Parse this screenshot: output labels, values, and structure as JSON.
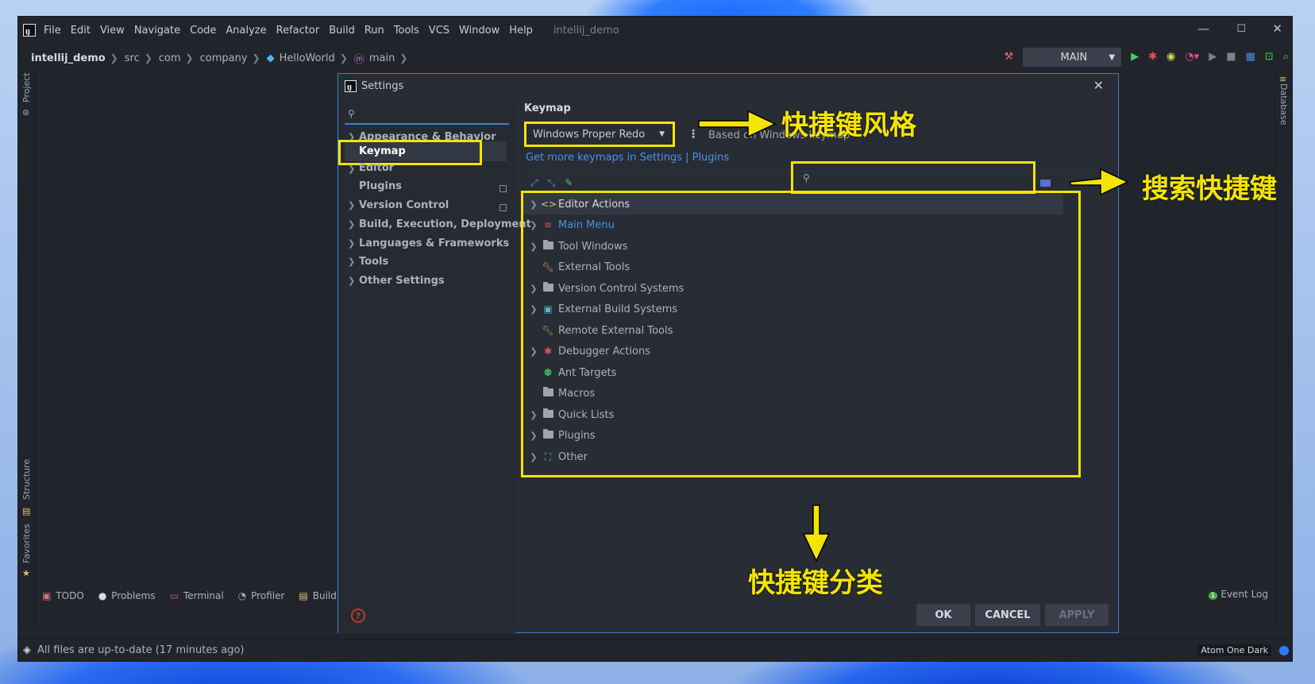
{
  "menubar": {
    "items": [
      "File",
      "Edit",
      "View",
      "Navigate",
      "Code",
      "Analyze",
      "Refactor",
      "Build",
      "Run",
      "Tools",
      "VCS",
      "Window",
      "Help"
    ],
    "project": "intellij_demo"
  },
  "breadcrumb": {
    "items": [
      "intellij_demo",
      "src",
      "com",
      "company",
      "HelloWorld",
      "main"
    ]
  },
  "toolbar": {
    "run_config": "MAIN"
  },
  "left_tools": {
    "project": "Project",
    "structure": "Structure",
    "favorites": "Favorites"
  },
  "right_tools": {
    "database": "Database"
  },
  "bottom_tabs": [
    "TODO",
    "Problems",
    "Terminal",
    "Profiler",
    "Build"
  ],
  "status": {
    "text": "All files are up-to-date (17 minutes ago)",
    "theme": "Atom One Dark",
    "event_log": "Event Log"
  },
  "settings": {
    "title": "Settings",
    "nav": [
      "Appearance & Behavior",
      "Keymap",
      "Editor",
      "Plugins",
      "Version Control",
      "Build, Execution, Deployment",
      "Languages & Frameworks",
      "Tools",
      "Other Settings"
    ],
    "keymap": {
      "header": "Keymap",
      "selected": "Windows Proper Redo",
      "based_on": "Based on Windows keymap",
      "link": "Get more keymaps in Settings | Plugins",
      "tree": [
        "Editor Actions",
        "Main Menu",
        "Tool Windows",
        "External Tools",
        "Version Control Systems",
        "External Build Systems",
        "Remote External Tools",
        "Debugger Actions",
        "Ant Targets",
        "Macros",
        "Quick Lists",
        "Plugins",
        "Other"
      ]
    },
    "buttons": {
      "ok": "OK",
      "cancel": "CANCEL",
      "apply": "APPLY"
    }
  },
  "annotations": {
    "style": "快捷键风格",
    "search": "搜索快捷键",
    "category": "快捷键分类"
  },
  "colors": {
    "annotation": "#f5e400",
    "link": "#4c8fea",
    "background": "#282c34"
  }
}
